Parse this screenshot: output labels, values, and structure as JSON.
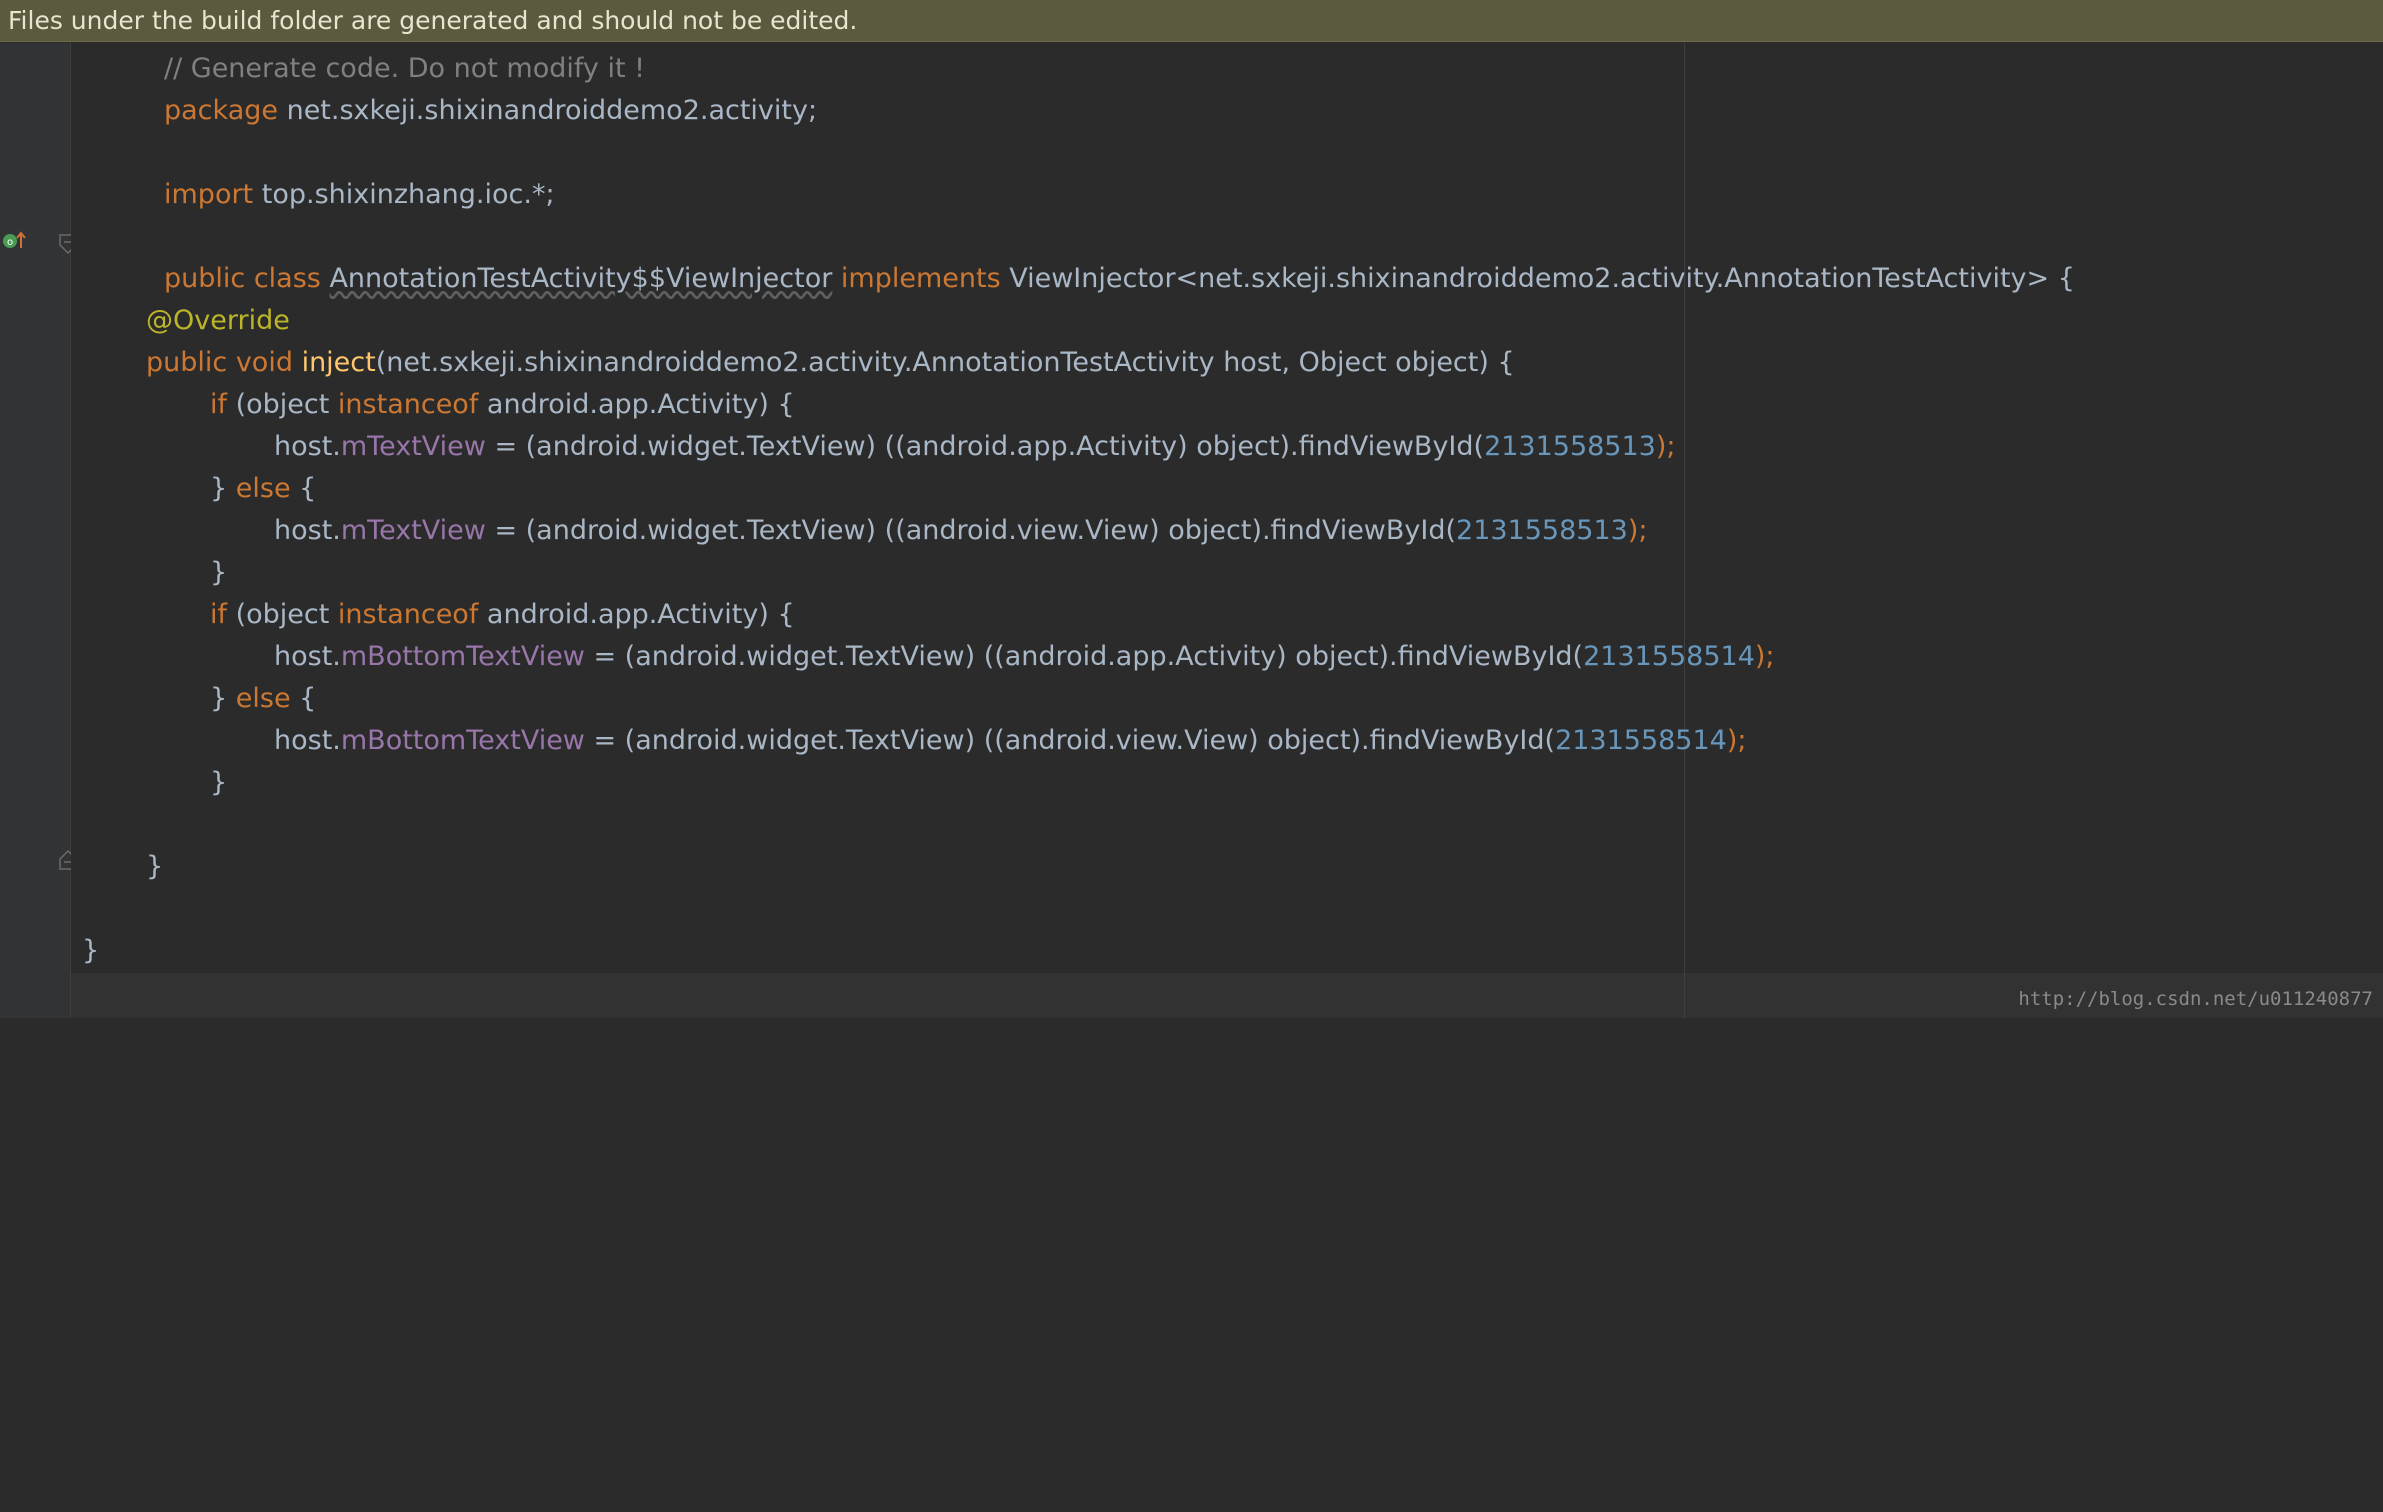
{
  "banner": {
    "text": "Files under the build folder are generated and should not be edited."
  },
  "code": {
    "l1": {
      "comment": "// Generate code. Do not modify it !"
    },
    "l2": {
      "kw": "package",
      "rest": " net.sxkeji.shixinandroiddemo2.activity;"
    },
    "l4": {
      "kw": "import",
      "rest": " top.shixinzhang.ioc.*;"
    },
    "l6": {
      "kw1": "public class",
      "cls": "AnnotationTestActivity$$ViewInjector",
      "kw2": "implements",
      "rest": " ViewInjector<net.sxkeji.shixinandroiddemo2.activity.AnnotationTestActivity> {"
    },
    "l7": {
      "ann": "@Override"
    },
    "l8": {
      "kw": "public void",
      "fn": "inject",
      "rest": "(net.sxkeji.shixinandroiddemo2.activity.AnnotationTestActivity host, Object object) {"
    },
    "l9": {
      "kw1": "if",
      "a": " (object ",
      "kw2": "instanceof",
      "b": " android.app.Activity) {"
    },
    "l10": {
      "a": "host.",
      "fld": "mTextView",
      "b": " = (android.widget.TextView) ((android.app.Activity) object).findViewById(",
      "num": "2131558513",
      "c": ");"
    },
    "l11": {
      "a": "} ",
      "kw": "else",
      "b": " {"
    },
    "l12": {
      "a": "host.",
      "fld": "mTextView",
      "b": " = (android.widget.TextView) ((android.view.View) object).findViewById(",
      "num": "2131558513",
      "c": ");"
    },
    "l13": {
      "a": "}"
    },
    "l14": {
      "kw1": "if",
      "a": " (object ",
      "kw2": "instanceof",
      "b": " android.app.Activity) {"
    },
    "l15": {
      "a": "host.",
      "fld": "mBottomTextView",
      "b": " = (android.widget.TextView) ((android.app.Activity) object).findViewById(",
      "num": "2131558514",
      "c": ");"
    },
    "l16": {
      "a": "} ",
      "kw": "else",
      "b": " {"
    },
    "l17": {
      "a": "host.",
      "fld": "mBottomTextView",
      "b": " = (android.widget.TextView) ((android.view.View) object).findViewById(",
      "num": "2131558514",
      "c": ");"
    },
    "l18": {
      "a": "}"
    },
    "l20": {
      "a": "}"
    },
    "l22": {
      "a": "}"
    }
  },
  "gutter": {
    "override_icon": "override-method-icon",
    "fold_icons": [
      "fold-start-icon",
      "fold-end-icon"
    ]
  },
  "watermark": {
    "text": "http://blog.csdn.net/u011240877"
  },
  "colors": {
    "background": "#2b2b2b",
    "keyword": "#cc7832",
    "comment": "#808080",
    "annotation": "#bbb529",
    "field": "#9876aa",
    "number": "#6897bb",
    "function": "#ffc66d",
    "plain": "#a9b7c6",
    "banner": "#5c5a3e"
  }
}
